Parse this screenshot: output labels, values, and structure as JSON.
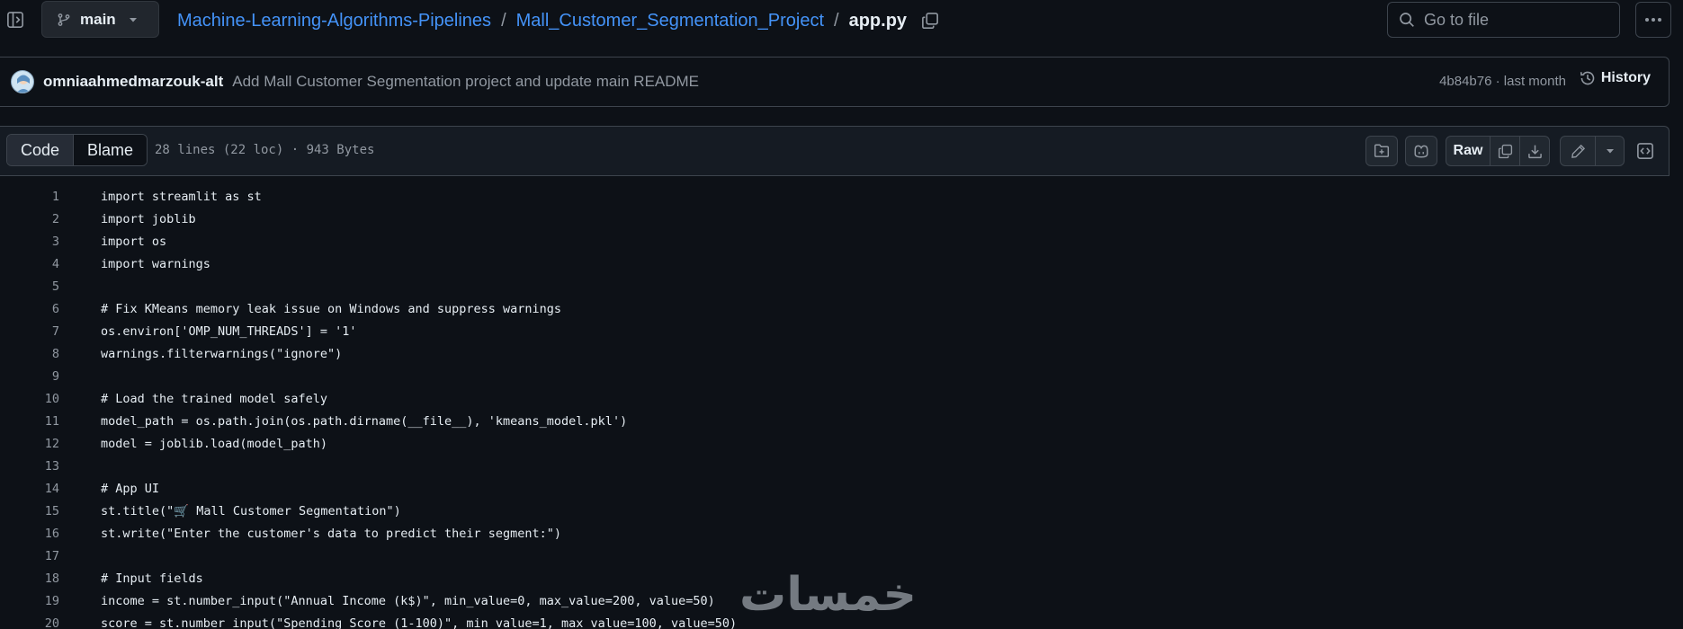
{
  "header": {
    "branch": "main",
    "breadcrumb": {
      "repo": "Machine-Learning-Algorithms-Pipelines",
      "folder": "Mall_Customer_Segmentation_Project",
      "file": "app.py",
      "separator": "/"
    },
    "goto_placeholder": "Go to file"
  },
  "commit": {
    "author": "omniaahmedmarzouk-alt",
    "message": "Add Mall Customer Segmentation project and update main README",
    "sha_time": "4b84b76 · last month",
    "history_label": "History"
  },
  "file_header": {
    "tabs": [
      "Code",
      "Blame"
    ],
    "active_tab": "Code",
    "info": "28 lines (22 loc) · 943 Bytes",
    "raw_label": "Raw"
  },
  "code_lines": [
    {
      "n": "1",
      "text": "import streamlit as st"
    },
    {
      "n": "2",
      "text": "import joblib"
    },
    {
      "n": "3",
      "text": "import os"
    },
    {
      "n": "4",
      "text": "import warnings"
    },
    {
      "n": "5",
      "text": ""
    },
    {
      "n": "6",
      "text": "# Fix KMeans memory leak issue on Windows and suppress warnings"
    },
    {
      "n": "7",
      "text": "os.environ['OMP_NUM_THREADS'] = '1'"
    },
    {
      "n": "8",
      "text": "warnings.filterwarnings(\"ignore\")"
    },
    {
      "n": "9",
      "text": ""
    },
    {
      "n": "10",
      "text": "# Load the trained model safely"
    },
    {
      "n": "11",
      "text": "model_path = os.path.join(os.path.dirname(__file__), 'kmeans_model.pkl')"
    },
    {
      "n": "12",
      "text": "model = joblib.load(model_path)"
    },
    {
      "n": "13",
      "text": ""
    },
    {
      "n": "14",
      "text": "# App UI"
    },
    {
      "n": "15",
      "text": "st.title(\"🛒 Mall Customer Segmentation\")"
    },
    {
      "n": "16",
      "text": "st.write(\"Enter the customer's data to predict their segment:\")"
    },
    {
      "n": "17",
      "text": ""
    },
    {
      "n": "18",
      "text": "# Input fields"
    },
    {
      "n": "19",
      "text": "income = st.number_input(\"Annual Income (k$)\", min_value=0, max_value=200, value=50)"
    },
    {
      "n": "20",
      "text": "score = st.number_input(\"Spending Score (1-100)\", min_value=1, max_value=100, value=50)"
    }
  ],
  "watermark": "خمسات",
  "colors": {
    "background": "#0d1117",
    "link": "#4493f8",
    "muted": "#9198a1",
    "border": "#3d444d",
    "text": "#e6edf3"
  },
  "icons": {
    "sidebar_toggle": "sidebar-collapse-icon",
    "branch": "git-branch-icon",
    "copy_path": "copy-icon",
    "search": "search-icon",
    "more": "kebab-horizontal-icon",
    "history": "history-icon",
    "add_file": "file-directory-add-icon",
    "copilot": "copilot-icon",
    "copy_raw": "copy-icon",
    "download": "download-icon",
    "edit": "pencil-icon",
    "edit_menu": "triangle-down-icon",
    "symbols": "code-square-icon"
  }
}
